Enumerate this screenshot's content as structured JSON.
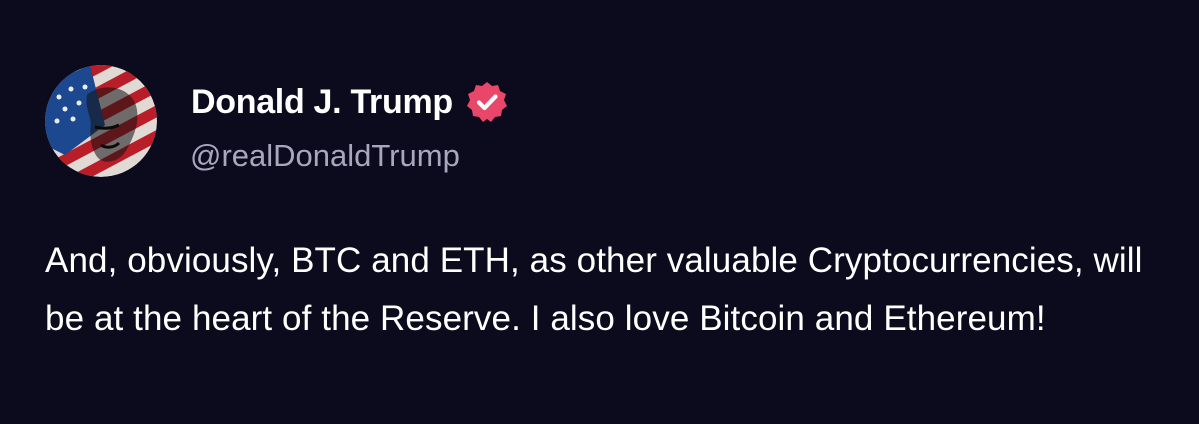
{
  "author": {
    "display_name": "Donald J. Trump",
    "handle": "@realDonaldTrump",
    "verified": true,
    "verified_icon": "verified-badge-icon",
    "avatar_icon": "profile-avatar"
  },
  "post": {
    "text": "And, obviously, BTC and ETH, as other valuable Cryptocurrencies, will be at the heart of the Reserve. I also love Bitcoin and Ethereum!"
  },
  "colors": {
    "background": "#0c0a1d",
    "text": "#ffffff",
    "handle": "#a9a6bd",
    "verified_badge": "#e8476a"
  }
}
